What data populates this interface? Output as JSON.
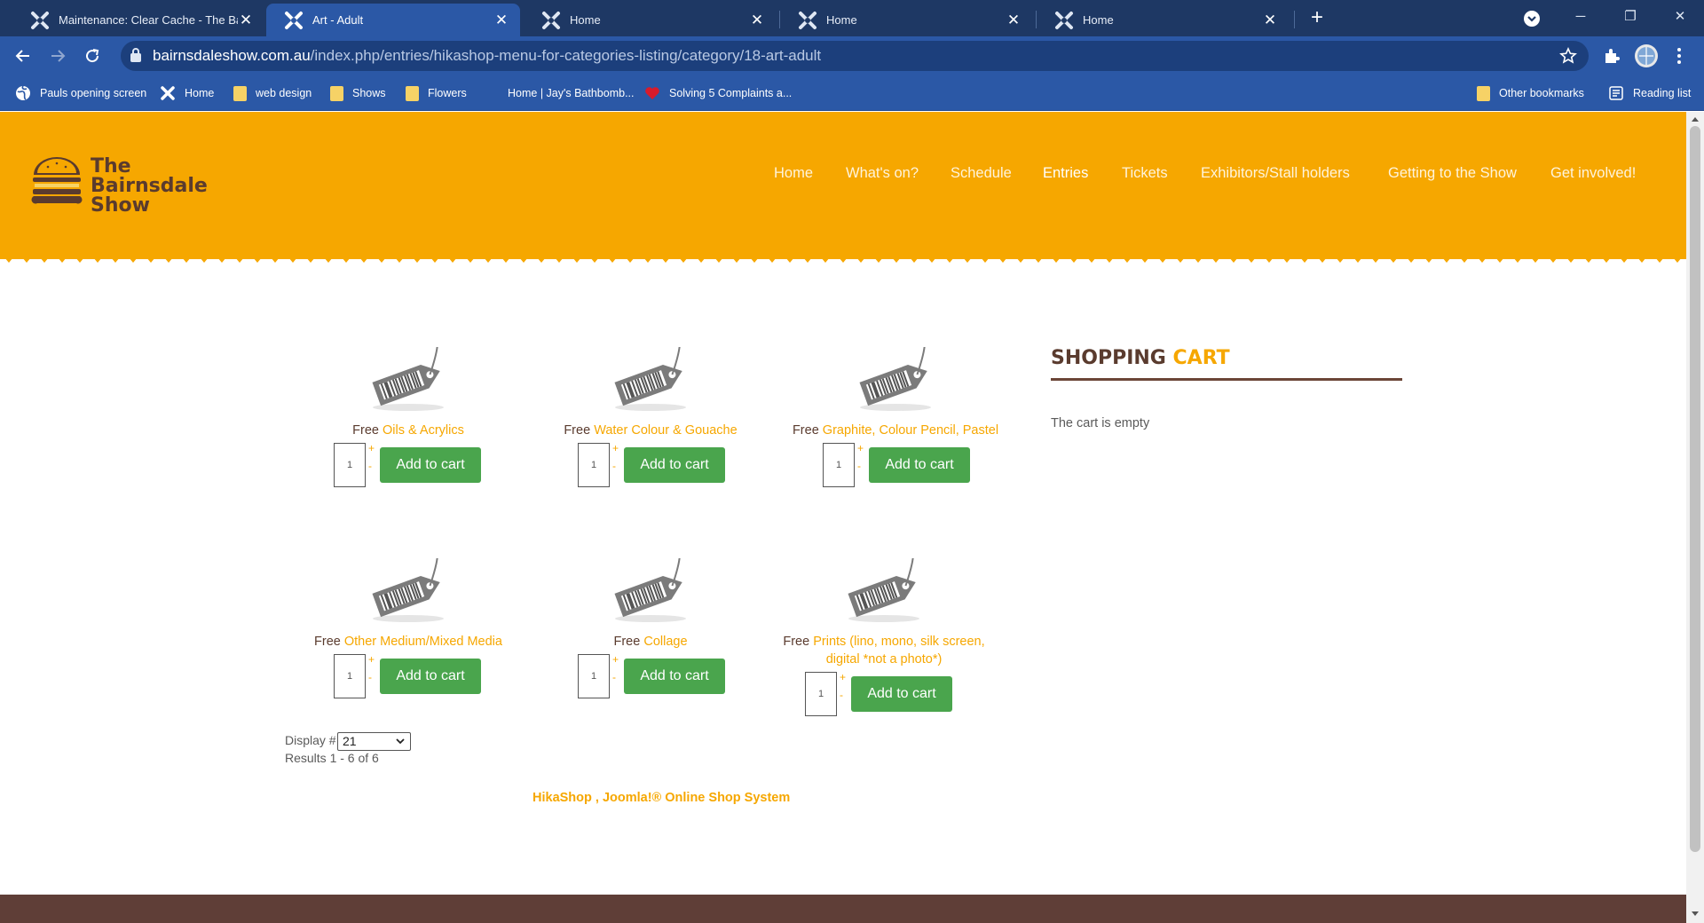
{
  "browser": {
    "tabs": [
      {
        "title": "Maintenance: Clear Cache - The Bairnsd",
        "active": false
      },
      {
        "title": "Art - Adult",
        "active": true
      },
      {
        "title": "Home",
        "active": false
      },
      {
        "title": "Home",
        "active": false
      },
      {
        "title": "Home",
        "active": false
      }
    ],
    "url_host": "bairnsdaleshow.com.au",
    "url_path": "/index.php/entries/hikashop-menu-for-categories-listing/category/18-art-adult",
    "bookmarks": [
      {
        "label": "Pauls opening screen",
        "icon": "globe-icon"
      },
      {
        "label": "Home",
        "icon": "joomla-icon"
      },
      {
        "label": "web design",
        "icon": "folder-icon"
      },
      {
        "label": "Shows",
        "icon": "folder-icon"
      },
      {
        "label": "Flowers",
        "icon": "folder-icon"
      },
      {
        "label": "Home | Jay's Bathbomb...",
        "icon": "none"
      },
      {
        "label": "Solving 5 Complaints a...",
        "icon": "heart-icon"
      }
    ],
    "other_bookmarks": "Other bookmarks",
    "reading_list": "Reading list",
    "colors": {
      "tabbar": "#1e3864",
      "toolbar": "#2b58a6"
    }
  },
  "site": {
    "logo_lines": [
      "The",
      "Bairnsdale",
      "Show"
    ],
    "nav": [
      "Home",
      "What's on?",
      "Schedule",
      "Entries",
      "Tickets",
      "Exhibitors/Stall holders",
      "Getting to the Show",
      "Get involved!"
    ],
    "active_nav": "Entries",
    "colors": {
      "header": "#f6a700",
      "brown": "#5a3b2e",
      "button": "#4aa54d",
      "footer": "#5f3e37"
    }
  },
  "products": [
    {
      "price": "Free",
      "name": "Oils & Acrylics",
      "qty": "1",
      "button": "Add to cart"
    },
    {
      "price": "Free",
      "name": "Water Colour & Gouache",
      "qty": "1",
      "button": "Add to cart"
    },
    {
      "price": "Free",
      "name": "Graphite, Colour Pencil, Pastel",
      "qty": "1",
      "button": "Add to cart"
    },
    {
      "price": "Free",
      "name": "Other Medium/Mixed Media",
      "qty": "1",
      "button": "Add to cart"
    },
    {
      "price": "Free",
      "name": "Collage",
      "qty": "1",
      "button": "Add to cart"
    },
    {
      "price": "Free",
      "name": "Prints (lino, mono, silk screen, digital *not a photo*)",
      "qty": "1",
      "button": "Add to cart"
    }
  ],
  "quantity_controls": {
    "plus": "+",
    "minus": "-"
  },
  "listing": {
    "display_label": "Display #",
    "display_value": "21",
    "results": "Results 1 - 6 of 6",
    "credit": "HikaShop , Joomla!® Online Shop System"
  },
  "cart": {
    "title_main": "SHOPPING ",
    "title_accent": "CART",
    "empty_text": "The cart is empty"
  }
}
